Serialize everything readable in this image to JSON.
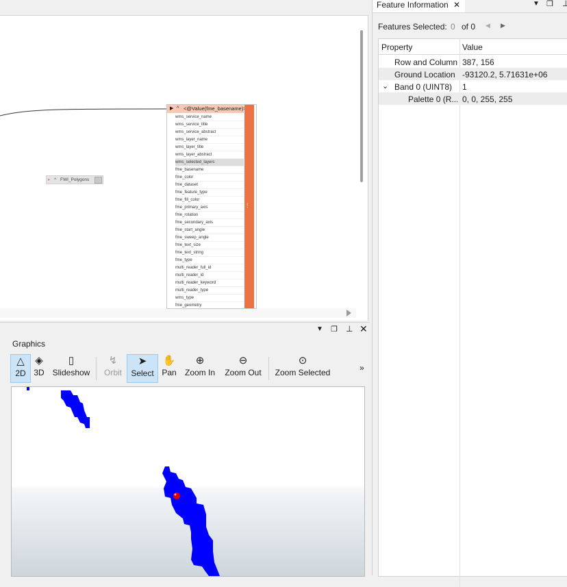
{
  "canvas": {
    "feature_box": {
      "title": "<@Value(fme_basename)>",
      "attributes": [
        "wms_service_name",
        "wms_service_title",
        "wms_service_abstract",
        "wms_layer_name",
        "wms_layer_title",
        "wms_layer_abstract",
        "wms_selected_layers",
        "fme_basename",
        "fme_color",
        "fme_dataset",
        "fme_feature_type",
        "fme_fill_color",
        "fme_primary_axis",
        "fme_rotation",
        "fme_secondary_axis",
        "fme_start_angle",
        "fme_sweep_angle",
        "fme_text_size",
        "fme_text_string",
        "fme_type",
        "multi_reader_full_id",
        "multi_reader_id",
        "multi_reader_keyword",
        "multi_reader_type",
        "wms_type",
        "fme_geometry"
      ],
      "selected_index": 6
    },
    "polygons_node": {
      "label": "FWI_Polygons"
    }
  },
  "graphics": {
    "tab_label": "Graphics",
    "toolbar": {
      "btn_2d": "2D",
      "btn_3d": "3D",
      "btn_slideshow": "Slideshow",
      "btn_orbit": "Orbit",
      "btn_select": "Select",
      "btn_pan": "Pan",
      "btn_zoom_in": "Zoom In",
      "btn_zoom_out": "Zoom Out",
      "btn_zoom_selected": "Zoom Selected"
    },
    "colors": {
      "raster": "#0000ff",
      "marker": "#e00000"
    }
  },
  "feature_info": {
    "tab_title": "Feature Information",
    "selected_label": "Features Selected:",
    "selected_count": "0",
    "of_total": "of 0",
    "columns": {
      "property": "Property",
      "value": "Value"
    },
    "rows": [
      {
        "property": "Row and Column",
        "value": "387, 156"
      },
      {
        "property": "Ground Location",
        "value": "-93120.2, 5.71631e+06"
      },
      {
        "property": "Band 0 (UINT8)",
        "value": "1"
      },
      {
        "property": "Palette 0 (R...",
        "value": "0, 0, 255, 255"
      }
    ]
  }
}
